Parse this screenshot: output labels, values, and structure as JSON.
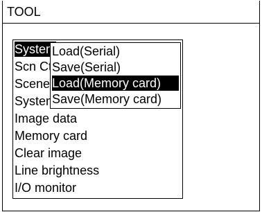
{
  "window": {
    "title": "TOOL"
  },
  "menu": {
    "items": [
      {
        "label": "System",
        "highlighted": true
      },
      {
        "label": "Scn Ctrl"
      },
      {
        "label": "Scene"
      },
      {
        "label": "System"
      },
      {
        "label": "Image data"
      },
      {
        "label": "Memory card"
      },
      {
        "label": "Clear image"
      },
      {
        "label": "Line brightness"
      },
      {
        "label": "I/O monitor"
      }
    ]
  },
  "submenu": {
    "items": [
      {
        "label": "Load(Serial)"
      },
      {
        "label": "Save(Serial)"
      },
      {
        "label": "Load(Memory card)",
        "highlighted": true
      },
      {
        "label": "Save(Memory card)"
      }
    ]
  }
}
